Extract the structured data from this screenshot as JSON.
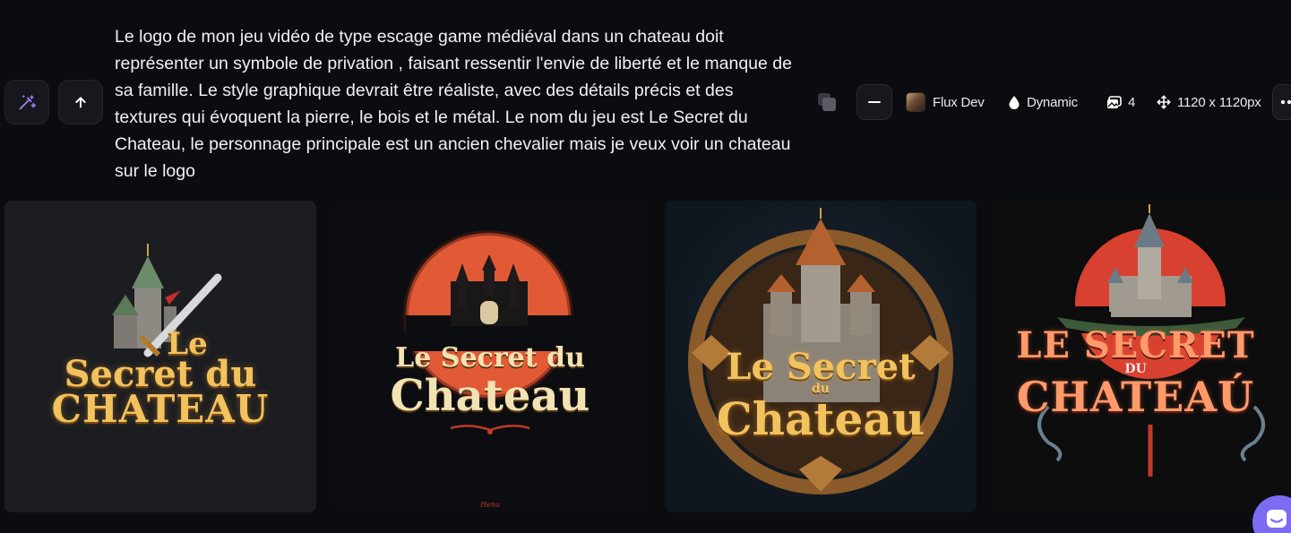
{
  "prompt": {
    "text": "Le logo de mon jeu vidéo de type escage game médiéval dans un chateau doit représenter un symbole de privation , faisant ressentir l'envie de liberté et le manque de sa famille. Le style graphique devrait être réaliste, avec des détails précis et des textures qui évoquent la pierre, le bois et le métal. Le nom du jeu est Le Secret du Chateau, le personnage principale est un ancien chevalier mais je veux voir un chateau sur le logo"
  },
  "left_actions": {
    "magic_icon": "magic-wand-icon",
    "upload_icon": "arrow-up-icon"
  },
  "toolbar": {
    "model": "Flux Dev",
    "style": "Dynamic",
    "image_count": "4",
    "dimensions": "1120 x 1120px",
    "icons": [
      "copy-icon",
      "minus-icon",
      "drop-icon",
      "images-icon",
      "move-icon",
      "more-icon"
    ]
  },
  "images": [
    {
      "title_line1": "Le",
      "title_line2": "Secret du",
      "title_line3": "CHATEAU"
    },
    {
      "title_line1": "Le Secret du",
      "title_line2": "Chateau",
      "signature": "Heno"
    },
    {
      "title_line1": "Le Secret",
      "title_line2": "du",
      "title_line3": "Chateau"
    },
    {
      "title_line1": "LE SECRET",
      "title_line2": "DU",
      "title_line3": "CHATEAÚ"
    }
  ],
  "colors": {
    "background": "#0b0c10",
    "accent": "#7c6cf2",
    "magic_icon": "#a37cf5"
  }
}
